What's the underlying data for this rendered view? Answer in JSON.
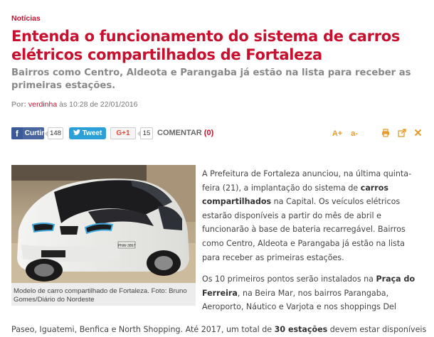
{
  "section": "Notícias",
  "headline": "Entenda o funcionamento do sistema de carros elétricos compartilhados de Fortaleza",
  "subheadline": "Bairros como Centro, Aldeota e Parangaba já estão na lista para receber as primeiras estações.",
  "byline": {
    "prefix": "Por:",
    "author": "verdinha",
    "time": "às 10:28 de 22/01/2016"
  },
  "toolbar": {
    "facebook_label": "Curtir",
    "facebook_icon": "f",
    "facebook_count": "148",
    "twitter_label": "Tweet",
    "gplus_label": "G+1",
    "gplus_count": "15",
    "comment_label": "COMENTAR",
    "comment_count": "(0)",
    "font_increase": "A+",
    "font_decrease": "a-"
  },
  "figure": {
    "plate": "PNW-3867",
    "caption": "Modelo de carro compartilhado de Fortaleza. Foto: Bruno Gomes/Diário do Nordeste"
  },
  "article": {
    "p1": {
      "a": "A Prefeitura de Fortaleza anunciou, na última quinta-feira (21), a implantação do sistema de ",
      "b": "carros compartilhados",
      "c": " na Capital. Os veículos elétricos estarão disponíveis a partir do mês de abril e funcionarão à base de bateria recarregável. Bairros como Centro, Aldeota e Parangaba já estão na lista para receber as primeiras estações."
    },
    "p2": {
      "a": "Os 10 primeiros pontos serão instalados na ",
      "b": "Praça do Ferreira",
      "c": ", na Beira Mar, nos bairros Parangaba, Aeroporto, Náutico e Varjota e nos shoppings Del"
    },
    "p3": {
      "a": "Paseo, Iguatemi, Benfica e North Shopping. Até 2017, um total de ",
      "b": "30 estações",
      "c": " devem estar disponíveis"
    }
  },
  "colors": {
    "accent": "#c8102e",
    "facebook": "#3b5998",
    "twitter": "#2b9fd8",
    "tools": "#e69b2c"
  }
}
